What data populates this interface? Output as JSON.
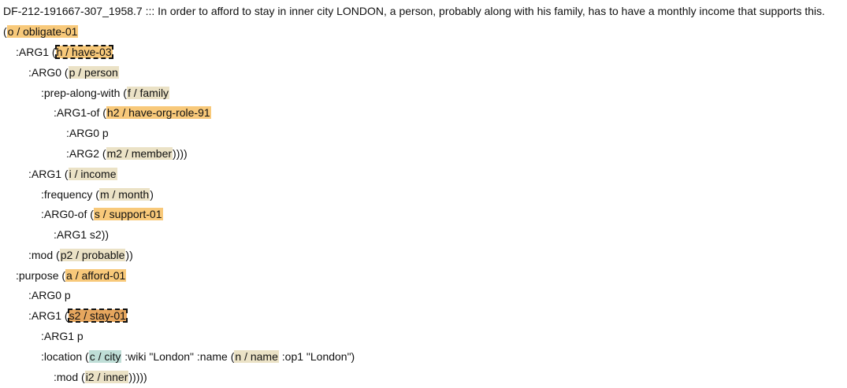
{
  "sentence": "DF-212-191667-307_1958.7 ::: In order to afford to stay in inner city LONDON, a person, probably along with his family, has to have a monthly income that supports this.",
  "lines": [
    [
      {
        "t": "("
      },
      {
        "t": "o / obligate-01",
        "c": "orange"
      }
    ],
    [
      {
        "t": ":ARG1 ("
      },
      {
        "t": "h / have-03",
        "c": "orange",
        "focus": true
      }
    ],
    [
      {
        "t": ":ARG0 ("
      },
      {
        "t": "p / person",
        "c": "beige"
      }
    ],
    [
      {
        "t": ":prep-along-with ("
      },
      {
        "t": "f / family",
        "c": "beige"
      }
    ],
    [
      {
        "t": ":ARG1-of ("
      },
      {
        "t": "h2 / have-org-role-91",
        "c": "orange"
      }
    ],
    [
      {
        "t": ":ARG0 p"
      }
    ],
    [
      {
        "t": ":ARG2 ("
      },
      {
        "t": "m2 / member",
        "c": "beige"
      },
      {
        "t": "))))"
      }
    ],
    [
      {
        "t": ":ARG1 ("
      },
      {
        "t": "i / income",
        "c": "beige"
      }
    ],
    [
      {
        "t": ":frequency ("
      },
      {
        "t": "m / month",
        "c": "beige"
      },
      {
        "t": ")"
      }
    ],
    [
      {
        "t": ":ARG0-of ("
      },
      {
        "t": "s / support-01",
        "c": "orange"
      }
    ],
    [
      {
        "t": ":ARG1 s2))"
      }
    ],
    [
      {
        "t": ":mod ("
      },
      {
        "t": "p2 / probable",
        "c": "beige"
      },
      {
        "t": "))"
      }
    ],
    [
      {
        "t": ":purpose ("
      },
      {
        "t": "a / afford-01",
        "c": "orange"
      }
    ],
    [
      {
        "t": ":ARG0 p"
      }
    ],
    [
      {
        "t": ":ARG1 ("
      },
      {
        "t": "s2 / stay-01",
        "c": "dark",
        "focus": true
      }
    ],
    [
      {
        "t": ":ARG1 p"
      }
    ],
    [
      {
        "t": ":location ("
      },
      {
        "t": "c / city",
        "c": "teal"
      },
      {
        "t": " :wiki \"London\" :name ("
      },
      {
        "t": "n / name",
        "c": "beige"
      },
      {
        "t": " :op1 \"London\")"
      }
    ],
    [
      {
        "t": ":mod ("
      },
      {
        "t": "i2 / inner",
        "c": "beige"
      },
      {
        "t": ")))))"
      }
    ]
  ]
}
